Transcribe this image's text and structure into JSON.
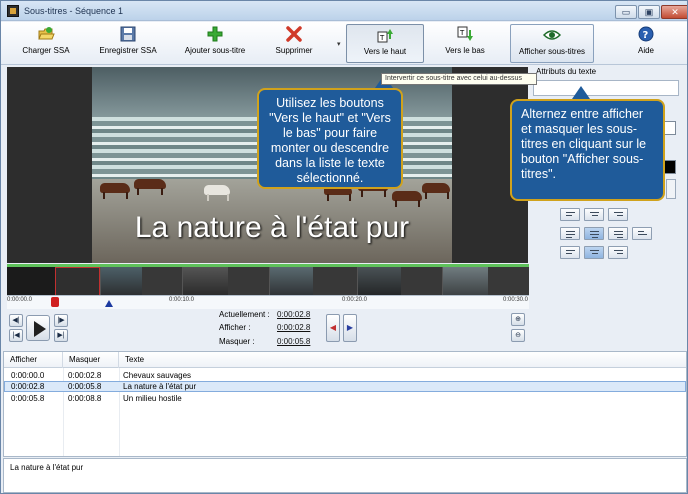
{
  "window": {
    "title": "Sous-titres - Séquence 1",
    "min_symbol": "▭",
    "max_symbol": "▣",
    "close_symbol": "✕"
  },
  "toolbar": {
    "load_label": "Charger SSA",
    "save_label": "Enregistrer SSA",
    "add_label": "Ajouter sous-titre",
    "delete_label": "Supprimer",
    "up_label": "Vers le haut",
    "down_label": "Vers le bas",
    "show_label": "Afficher sous-titres",
    "help_label": "Aide",
    "colors": {
      "green": "#3aaa35",
      "red": "#d03a2a",
      "blue": "#2a5fb0"
    }
  },
  "tooltip": "Intervertir ce sous-titre avec celui au-dessus",
  "video": {
    "subtitle_text": "La nature à l'état pur"
  },
  "callouts": {
    "left": "Utilisez les boutons \"Vers le haut\" et \"Vers le bas\" pour faire monter ou descendre dans la liste le texte sélectionné.",
    "right": "Alternez entre afficher et masquer les sous-titres en cliquant sur le bouton \"Afficher sous-titres\"."
  },
  "right_panel": {
    "attr_label": "Attributs du texte"
  },
  "ruler": {
    "t0": "0:00:00.0",
    "t1": "0:00:10.0",
    "t2": "0:00:20.0",
    "t3": "0:00:30.0"
  },
  "timing": {
    "current_label": "Actuellement :",
    "current_value": "0:00:02.8",
    "show_label": "Afficher :",
    "show_value": "0:00:02.8",
    "hide_label": "Masquer :",
    "hide_value": "0:00:05.8"
  },
  "table": {
    "headers": [
      "Afficher",
      "Masquer",
      "Texte"
    ],
    "rows": [
      {
        "show": "0:00:00.0",
        "hide": "0:00:02.8",
        "text": "Chevaux sauvages"
      },
      {
        "show": "0:00:02.8",
        "hide": "0:00:05.8",
        "text": "La nature à l'état pur"
      },
      {
        "show": "0:00:05.8",
        "hide": "0:00:08.8",
        "text": "Un milieu hostile"
      }
    ]
  },
  "editor": {
    "text": "La nature à l'état pur"
  }
}
